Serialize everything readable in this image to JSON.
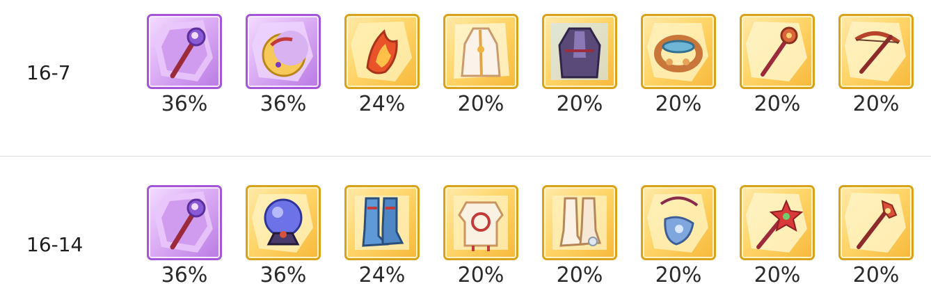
{
  "rows": [
    {
      "stage": "16-7",
      "items": [
        {
          "rarity": "purple",
          "icon": "staff-icon",
          "rate": "36%"
        },
        {
          "rarity": "purple",
          "icon": "crescent-charm-icon",
          "rate": "36%"
        },
        {
          "rarity": "gold",
          "icon": "flame-mask-icon",
          "rate": "24%"
        },
        {
          "rarity": "gold",
          "icon": "white-robe-icon",
          "rate": "20%"
        },
        {
          "rarity": "gold",
          "icon": "dark-cloak-icon",
          "rate": "20%"
        },
        {
          "rarity": "gold",
          "icon": "bracelet-icon",
          "rate": "20%"
        },
        {
          "rarity": "gold",
          "icon": "scepter-icon",
          "rate": "20%"
        },
        {
          "rarity": "gold",
          "icon": "crossbow-icon",
          "rate": "20%"
        }
      ]
    },
    {
      "stage": "16-14",
      "items": [
        {
          "rarity": "purple",
          "icon": "staff-icon",
          "rate": "36%"
        },
        {
          "rarity": "gold",
          "icon": "crystal-orb-icon",
          "rate": "36%"
        },
        {
          "rarity": "gold",
          "icon": "boots-icon",
          "rate": "24%"
        },
        {
          "rarity": "gold",
          "icon": "armor-icon",
          "rate": "20%"
        },
        {
          "rarity": "gold",
          "icon": "greaves-icon",
          "rate": "20%"
        },
        {
          "rarity": "gold",
          "icon": "amulet-icon",
          "rate": "20%"
        },
        {
          "rarity": "gold",
          "icon": "star-wand-icon",
          "rate": "20%"
        },
        {
          "rarity": "gold",
          "icon": "ornate-staff-icon",
          "rate": "20%"
        }
      ]
    }
  ],
  "colors": {
    "gold_border": "#d9a21b",
    "purple_border": "#a455d8",
    "divider": "#dcdcdc"
  }
}
